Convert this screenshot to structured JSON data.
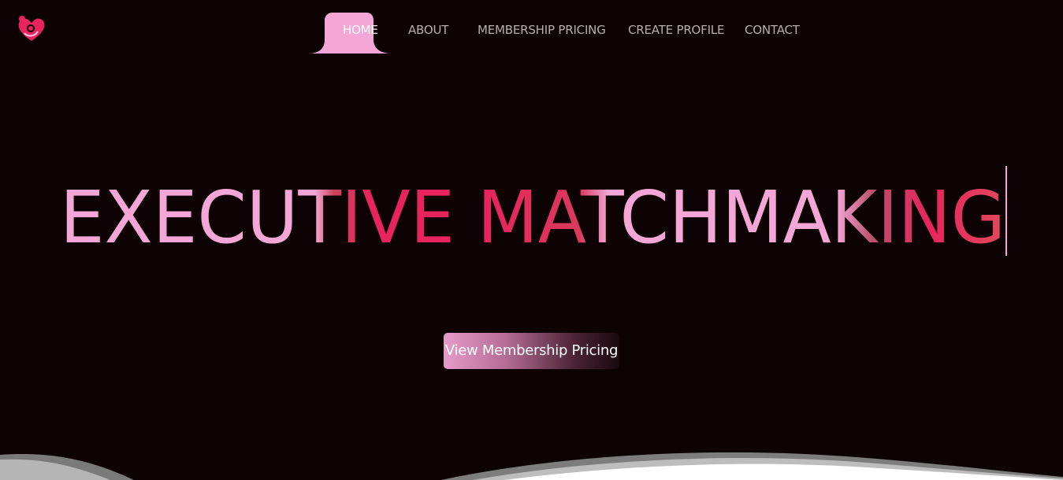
{
  "nav": {
    "items": [
      {
        "label": "HOME",
        "active": true
      },
      {
        "label": "ABOUT",
        "active": false
      },
      {
        "label": "MEMBERSHIP PRICING",
        "active": false
      },
      {
        "label": "CREATE PROFILE",
        "active": false
      },
      {
        "label": "CONTACT",
        "active": false
      }
    ]
  },
  "hero": {
    "title": "EXECUTIVE MATCHMAKING",
    "cta_label": "View Membership Pricing"
  },
  "colors": {
    "background": "#0d0204",
    "accent_pink": "#f4a7d6",
    "accent_magenta": "#e8245e",
    "nav_text": "#b7aeb0"
  },
  "icons": {
    "logo": "heart-people-logo-icon"
  }
}
